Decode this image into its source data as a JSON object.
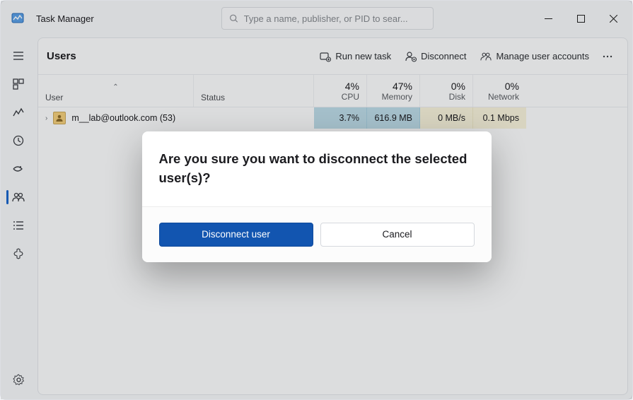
{
  "app": {
    "title": "Task Manager"
  },
  "search": {
    "placeholder": "Type a name, publisher, or PID to sear..."
  },
  "page": {
    "title": "Users"
  },
  "toolbar": {
    "run_new_task": "Run new task",
    "disconnect": "Disconnect",
    "manage_accounts": "Manage user accounts"
  },
  "columns": {
    "user": "User",
    "status": "Status",
    "cpu_pct": "4%",
    "cpu_lbl": "CPU",
    "mem_pct": "47%",
    "mem_lbl": "Memory",
    "disk_pct": "0%",
    "disk_lbl": "Disk",
    "net_pct": "0%",
    "net_lbl": "Network"
  },
  "rows": [
    {
      "user": "m__lab@outlook.com (53)",
      "status": "",
      "cpu": "3.7%",
      "mem": "616.9 MB",
      "disk": "0 MB/s",
      "net": "0.1 Mbps"
    }
  ],
  "dialog": {
    "message": "Are you sure you want to disconnect the selected user(s)?",
    "primary": "Disconnect user",
    "secondary": "Cancel"
  },
  "sidebar_icons": [
    "menu-icon",
    "processes-icon",
    "performance-icon",
    "app-history-icon",
    "startup-apps-icon",
    "users-icon",
    "details-icon",
    "services-icon"
  ]
}
